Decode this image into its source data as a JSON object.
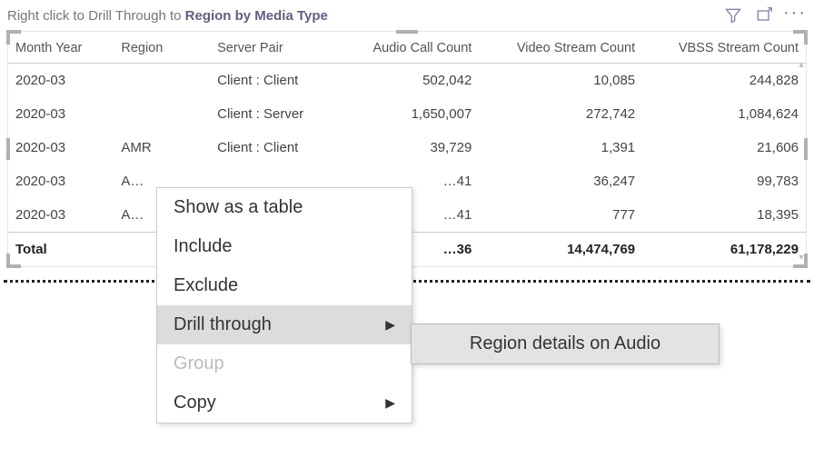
{
  "header": {
    "hint_prefix": "Right click to Drill Through to ",
    "hint_bold": "Region by Media Type"
  },
  "columns": {
    "month": "Month Year",
    "region": "Region",
    "server": "Server Pair",
    "audio": "Audio Call Count",
    "video": "Video Stream Count",
    "vbss": "VBSS Stream Count"
  },
  "rows": [
    {
      "month": "2020-03",
      "region": "",
      "server": "Client : Client",
      "audio": "502,042",
      "video": "10,085",
      "vbss": "244,828"
    },
    {
      "month": "2020-03",
      "region": "",
      "server": "Client : Server",
      "audio": "1,650,007",
      "video": "272,742",
      "vbss": "1,084,624"
    },
    {
      "month": "2020-03",
      "region": "AMR",
      "server": "Client : Client",
      "audio": "39,729",
      "video": "1,391",
      "vbss": "21,606"
    },
    {
      "month": "2020-03",
      "region": "A…",
      "server": "",
      "audio": "…41",
      "video": "36,247",
      "vbss": "99,783"
    },
    {
      "month": "2020-03",
      "region": "A…",
      "server": "",
      "audio": "…41",
      "video": "777",
      "vbss": "18,395"
    }
  ],
  "total": {
    "label": "Total",
    "audio": "…36",
    "video": "14,474,769",
    "vbss": "61,178,229"
  },
  "menu": {
    "show_table": "Show as a table",
    "include": "Include",
    "exclude": "Exclude",
    "drill": "Drill through",
    "group": "Group",
    "copy": "Copy"
  },
  "submenu": {
    "region_audio": "Region details on Audio"
  }
}
